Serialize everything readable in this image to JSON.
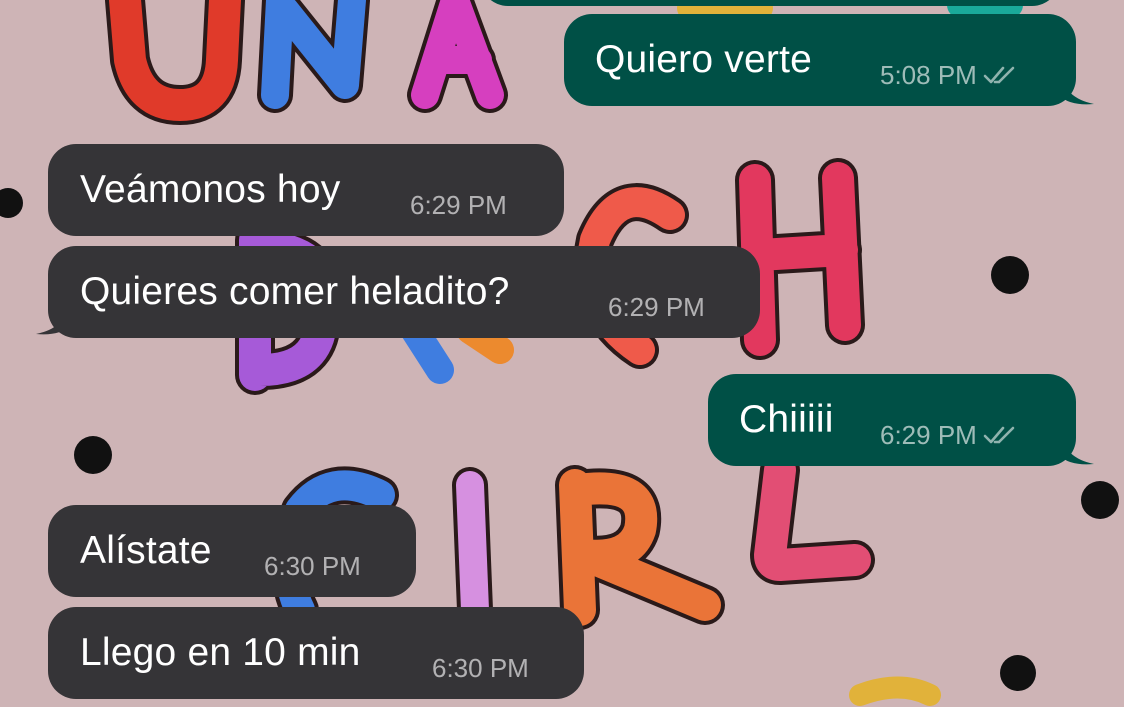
{
  "messages": [
    {
      "id": "m0",
      "direction": "outgoing",
      "text": "Quiero verte",
      "time": "5:08 PM",
      "read": true
    },
    {
      "id": "m1",
      "direction": "incoming",
      "text": "Veámonos hoy",
      "time": "6:29 PM"
    },
    {
      "id": "m2",
      "direction": "incoming",
      "text": "Quieres comer heladito?",
      "time": "6:29 PM"
    },
    {
      "id": "m3",
      "direction": "outgoing",
      "text": "Chiiiii",
      "time": "6:29 PM",
      "read": true
    },
    {
      "id": "m4",
      "direction": "incoming",
      "text": "Alístate",
      "time": "6:30 PM"
    },
    {
      "id": "m5",
      "direction": "incoming",
      "text": "Llego en 10 min",
      "time": "6:30 PM"
    }
  ],
  "wallpaper": {
    "lines": [
      "UNA",
      "BITCH",
      "GIRL"
    ],
    "background": "#ceb4b6"
  },
  "colors": {
    "incoming_bubble": "#353437",
    "outgoing_bubble": "#005046",
    "read_ticks": "#8fb3ae"
  }
}
